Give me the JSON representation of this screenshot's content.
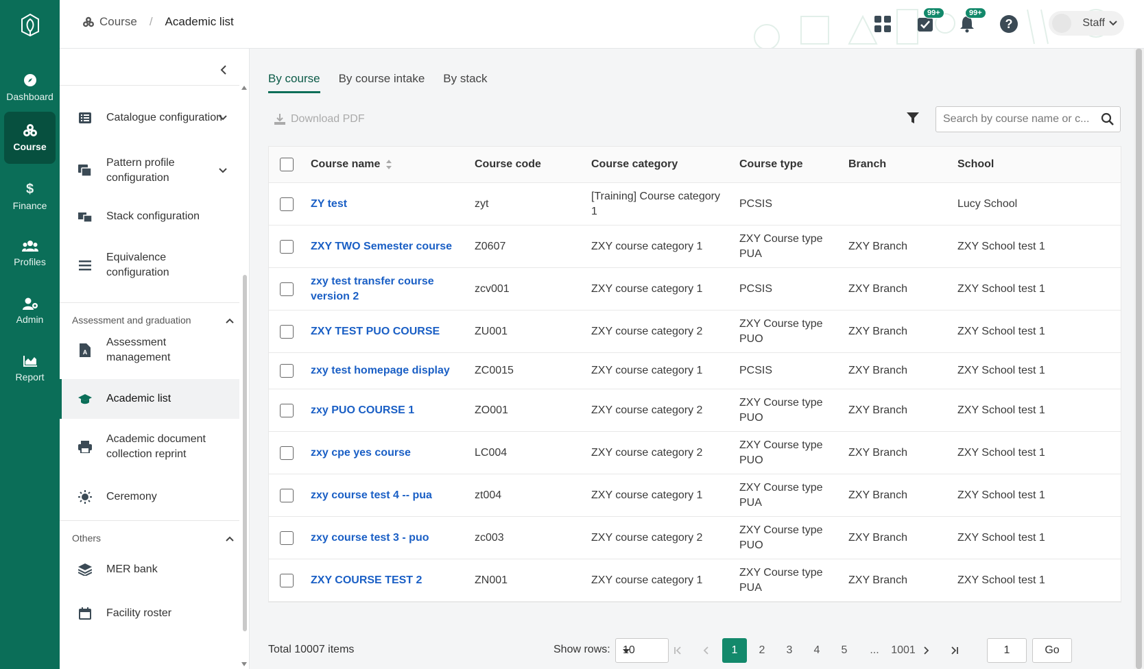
{
  "colors": {
    "brand": "#0b6e58",
    "brand_dark": "#07503f",
    "link": "#1a5fc5",
    "accent": "#13896b"
  },
  "rail": [
    {
      "label": "Dashboard",
      "icon": "compass-icon"
    },
    {
      "label": "Course",
      "icon": "blocks-icon",
      "active": true
    },
    {
      "label": "Finance",
      "icon": "dollar-icon"
    },
    {
      "label": "Profiles",
      "icon": "users-icon"
    },
    {
      "label": "Admin",
      "icon": "user-gear-icon"
    },
    {
      "label": "Report",
      "icon": "chart-icon"
    }
  ],
  "header": {
    "breadcrumb": {
      "root": "Course",
      "current": "Academic list"
    },
    "badges": {
      "tasks": "99+",
      "notifications": "99+"
    },
    "user": "Staff"
  },
  "sidebar": {
    "items": [
      {
        "label": "Catalogue configuration",
        "icon": "list-icon",
        "expandable": true
      },
      {
        "label": "Pattern profile configuration",
        "icon": "cards-icon",
        "expandable": true
      },
      {
        "label": "Stack configuration",
        "icon": "stack-config-icon"
      },
      {
        "label": "Equivalence configuration",
        "icon": "menu-icon"
      }
    ],
    "section_assessment": "Assessment and graduation",
    "assessment_items": [
      {
        "label": "Assessment management",
        "icon": "document-icon"
      },
      {
        "label": "Academic list",
        "icon": "graduation-cap-icon",
        "active": true
      },
      {
        "label": "Academic document collection reprint",
        "icon": "printer-icon"
      },
      {
        "label": "Ceremony",
        "icon": "sun-icon"
      }
    ],
    "section_others": "Others",
    "others_items": [
      {
        "label": "MER bank",
        "icon": "layers-icon"
      },
      {
        "label": "Facility roster",
        "icon": "calendar-icon"
      }
    ]
  },
  "tabs": [
    "By course",
    "By course intake",
    "By stack"
  ],
  "toolbar": {
    "download": "Download PDF",
    "search_placeholder": "Search by course name or c..."
  },
  "table": {
    "columns": [
      "Course name",
      "Course code",
      "Course category",
      "Course type",
      "Branch",
      "School"
    ],
    "rows": [
      {
        "name": "ZY test",
        "code": "zyt",
        "category": "[Training] Course category 1",
        "type": "PCSIS",
        "branch": "",
        "school": "Lucy School"
      },
      {
        "name": "ZXY TWO Semester course",
        "code": "Z0607",
        "category": "ZXY course category 1",
        "type": "ZXY Course type PUA",
        "branch": "ZXY Branch",
        "school": "ZXY School test 1"
      },
      {
        "name": "zxy test transfer course version 2",
        "code": "zcv001",
        "category": "ZXY course category 1",
        "type": "PCSIS",
        "branch": "ZXY Branch",
        "school": "ZXY School test 1"
      },
      {
        "name": "ZXY TEST PUO COURSE",
        "code": "ZU001",
        "category": "ZXY course category 2",
        "type": "ZXY Course type PUO",
        "branch": "ZXY Branch",
        "school": "ZXY School test 1"
      },
      {
        "name": "zxy test homepage display",
        "code": "ZC0015",
        "category": "ZXY course category 1",
        "type": "PCSIS",
        "branch": "ZXY Branch",
        "school": "ZXY School test 1"
      },
      {
        "name": "zxy PUO COURSE 1",
        "code": "ZO001",
        "category": "ZXY course category 2",
        "type": "ZXY Course type PUO",
        "branch": "ZXY Branch",
        "school": "ZXY School test 1"
      },
      {
        "name": "zxy cpe yes course",
        "code": "LC004",
        "category": "ZXY course category 2",
        "type": "ZXY Course type PUO",
        "branch": "ZXY Branch",
        "school": "ZXY School test 1"
      },
      {
        "name": "zxy course test 4 -- pua",
        "code": "zt004",
        "category": "ZXY course category 1",
        "type": "ZXY Course type PUA",
        "branch": "ZXY Branch",
        "school": "ZXY School test 1"
      },
      {
        "name": "zxy course test 3 - puo",
        "code": "zc003",
        "category": "ZXY course category 2",
        "type": "ZXY Course type PUO",
        "branch": "ZXY Branch",
        "school": "ZXY School test 1"
      },
      {
        "name": "ZXY COURSE TEST 2",
        "code": "ZN001",
        "category": "ZXY course category 1",
        "type": "ZXY Course type PUA",
        "branch": "ZXY Branch",
        "school": "ZXY School test 1"
      }
    ]
  },
  "pagination": {
    "total": "Total 10007 items",
    "show_rows_label": "Show rows:",
    "rows_per_page": "10",
    "pages": [
      "1",
      "2",
      "3",
      "4",
      "5",
      "...",
      "1001"
    ],
    "current": "1",
    "goto_value": "1",
    "go_label": "Go"
  }
}
